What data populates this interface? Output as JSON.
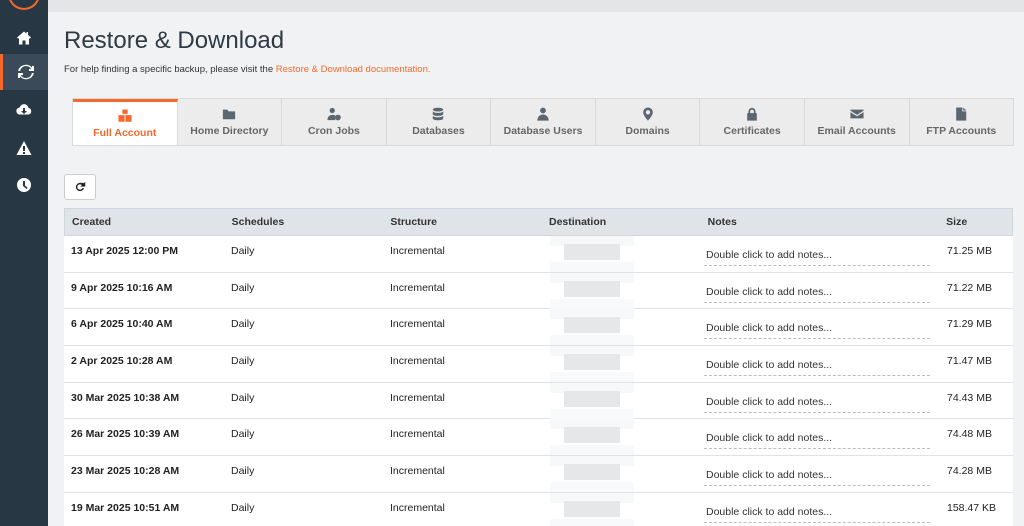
{
  "sidebar": {
    "items": [
      {
        "icon": "home-icon"
      },
      {
        "icon": "refresh-icon",
        "active": true
      },
      {
        "icon": "cloud-download-icon"
      },
      {
        "icon": "warning-icon"
      },
      {
        "icon": "clock-icon"
      }
    ]
  },
  "page": {
    "title": "Restore & Download",
    "help_prefix": "For help finding a specific backup, please visit the ",
    "help_link": "Restore & Download documentation."
  },
  "tabs": [
    {
      "label": "Full Account",
      "icon": "cubes-icon",
      "active": true
    },
    {
      "label": "Home Directory",
      "icon": "folder-icon"
    },
    {
      "label": "Cron Jobs",
      "icon": "user-clock-icon"
    },
    {
      "label": "Databases",
      "icon": "database-icon"
    },
    {
      "label": "Database Users",
      "icon": "user-tie-icon"
    },
    {
      "label": "Domains",
      "icon": "map-marker-icon"
    },
    {
      "label": "Certificates",
      "icon": "lock-icon"
    },
    {
      "label": "Email Accounts",
      "icon": "envelope-icon"
    },
    {
      "label": "FTP Accounts",
      "icon": "file-icon"
    }
  ],
  "table": {
    "headers": [
      "Created",
      "Schedules",
      "Structure",
      "Destination",
      "Notes",
      "Size"
    ],
    "notes_placeholder": "Double click to add notes...",
    "rows": [
      {
        "created": "13 Apr 2025 12:00 PM",
        "schedule": "Daily",
        "structure": "Incremental",
        "size": "71.25 MB"
      },
      {
        "created": "9 Apr 2025 10:16 AM",
        "schedule": "Daily",
        "structure": "Incremental",
        "size": "71.22 MB"
      },
      {
        "created": "6 Apr 2025 10:40 AM",
        "schedule": "Daily",
        "structure": "Incremental",
        "size": "71.29 MB"
      },
      {
        "created": "2 Apr 2025 10:28 AM",
        "schedule": "Daily",
        "structure": "Incremental",
        "size": "71.47 MB"
      },
      {
        "created": "30 Mar 2025 10:38 AM",
        "schedule": "Daily",
        "structure": "Incremental",
        "size": "74.43 MB"
      },
      {
        "created": "26 Mar 2025 10:39 AM",
        "schedule": "Daily",
        "structure": "Incremental",
        "size": "74.48 MB"
      },
      {
        "created": "23 Mar 2025 10:28 AM",
        "schedule": "Daily",
        "structure": "Incremental",
        "size": "74.28 MB"
      },
      {
        "created": "19 Mar 2025 10:51 AM",
        "schedule": "Daily",
        "structure": "Incremental",
        "size": "158.47 KB"
      }
    ]
  },
  "colors": {
    "accent": "#f5692b",
    "sidebar": "#283744"
  }
}
